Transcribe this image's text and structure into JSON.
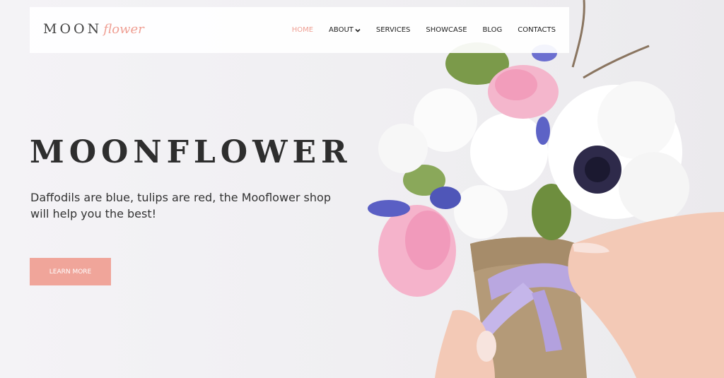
{
  "logo": {
    "main": "MOON",
    "accent": "flower"
  },
  "nav": {
    "items": [
      {
        "label": "HOME",
        "active": true
      },
      {
        "label": "ABOUT",
        "dropdown": true
      },
      {
        "label": "SERVICES"
      },
      {
        "label": "SHOWCASE"
      },
      {
        "label": "BLOG"
      },
      {
        "label": "CONTACTS"
      }
    ]
  },
  "hero": {
    "title": "MOONFLOWER",
    "text": "Daffodils are blue, tulips are red, the Mooflower shop will help you the best!",
    "button_label": "LEARN MORE"
  },
  "colors": {
    "accent": "#ef9f93",
    "button": "#f0a59a",
    "text_dark": "#2e2e2e"
  },
  "image": {
    "name": "flower-bouquet-with-hands"
  }
}
